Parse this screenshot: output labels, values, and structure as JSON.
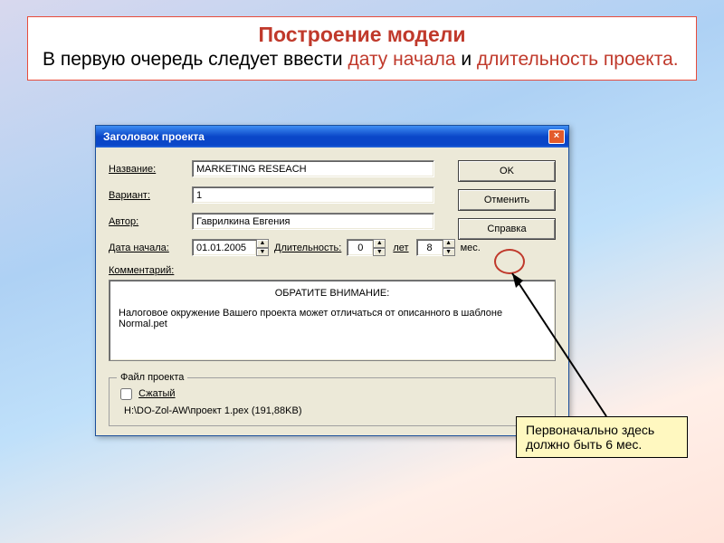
{
  "header": {
    "title": "Построение модели",
    "line1a": "В  первую очередь следует ввести ",
    "line1b": "дату начала",
    "line1c": " и ",
    "line2": "длительность проекта."
  },
  "dialog": {
    "title": "Заголовок проекта",
    "labels": {
      "name": "Название:",
      "variant": "Вариант:",
      "author": "Автор:",
      "startdate": "Дата начала:",
      "duration": "Длительность:",
      "years": "лет",
      "months": "мес.",
      "comment": "Комментарий:"
    },
    "values": {
      "name": "MARKETING RESEACH",
      "variant": "1",
      "author": "Гаврилкина Евгения",
      "startdate": "01.01.2005",
      "duration_years": "0",
      "duration_months": "8"
    },
    "comment": {
      "title": "ОБРАТИТЕ ВНИМАНИЕ:",
      "body": "Налоговое окружение Вашего проекта может отличаться от описанного в шаблоне Normal.pet"
    },
    "fileproject": {
      "legend": "Файл проекта",
      "compressed": "Сжатый",
      "path": "H:\\DO-Zol-AW\\проект 1.pex (191,88KB)"
    },
    "buttons": {
      "ok": "OK",
      "cancel": "Отменить",
      "help": "Справка"
    }
  },
  "callout": {
    "text": "Первоначально здесь должно быть 6 мес."
  }
}
